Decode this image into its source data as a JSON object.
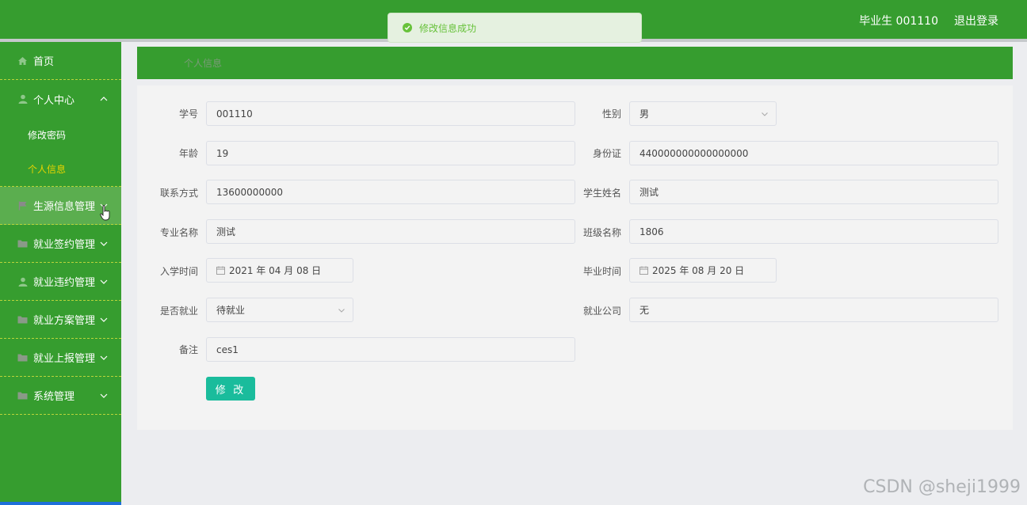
{
  "header": {
    "user": "毕业生 001110",
    "logout": "退出登录"
  },
  "toast": {
    "message": "修改信息成功"
  },
  "sidebar": {
    "items": [
      {
        "label": "首页",
        "icon": "home-icon"
      },
      {
        "label": "个人中心",
        "icon": "user-icon",
        "expanded": true
      },
      {
        "label": "生源信息管理",
        "icon": "flag-icon"
      },
      {
        "label": "就业签约管理",
        "icon": "folder-icon"
      },
      {
        "label": "就业违约管理",
        "icon": "user-icon"
      },
      {
        "label": "就业方案管理",
        "icon": "folder-icon"
      },
      {
        "label": "就业上报管理",
        "icon": "folder-icon"
      },
      {
        "label": "系统管理",
        "icon": "folder-icon"
      }
    ],
    "subitems": [
      {
        "label": "修改密码"
      },
      {
        "label": "个人信息"
      }
    ]
  },
  "page": {
    "title": "个人信息"
  },
  "form": {
    "student_id": {
      "label": "学号",
      "value": "001110"
    },
    "gender": {
      "label": "性别",
      "value": "男"
    },
    "age": {
      "label": "年龄",
      "value": "19"
    },
    "id_card": {
      "label": "身份证",
      "value": "440000000000000000"
    },
    "contact": {
      "label": "联系方式",
      "value": "13600000000"
    },
    "student_name": {
      "label": "学生姓名",
      "value": "测试"
    },
    "major": {
      "label": "专业名称",
      "value": "测试"
    },
    "class_name": {
      "label": "班级名称",
      "value": "1806"
    },
    "enroll_date": {
      "label": "入学时间",
      "value": "2021 年 04 月 08 日"
    },
    "grad_date": {
      "label": "毕业时间",
      "value": "2025 年 08 月 20 日"
    },
    "employed": {
      "label": "是否就业",
      "value": "待就业"
    },
    "company": {
      "label": "就业公司",
      "value": "无"
    },
    "remark": {
      "label": "备注",
      "value": "ces1"
    },
    "submit": "修 改"
  },
  "watermark": "CSDN @sheji1999",
  "colors": {
    "primary_green": "#369d2f",
    "submit_teal": "#1abc9c",
    "active_sub": "#e6d300",
    "success": "#67c23a"
  }
}
